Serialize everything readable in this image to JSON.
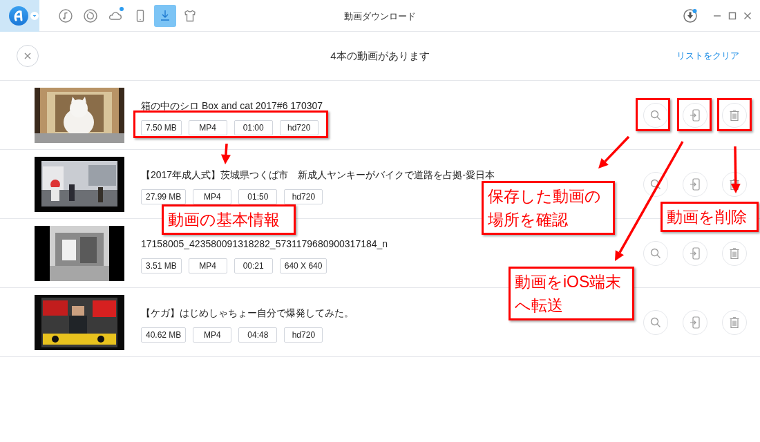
{
  "window": {
    "title": "動画ダウンロード"
  },
  "toolbar": [
    {
      "kind": "music",
      "selected": false,
      "notification": false
    },
    {
      "kind": "restore",
      "selected": false,
      "notification": false
    },
    {
      "kind": "cloud",
      "selected": false,
      "notification": true
    },
    {
      "kind": "phone",
      "selected": false,
      "notification": false
    },
    {
      "kind": "download",
      "selected": true,
      "notification": false
    },
    {
      "kind": "shirt",
      "selected": false,
      "notification": false
    }
  ],
  "download_status": {
    "notification": true
  },
  "header": {
    "title": "4本の動画があります",
    "clear_link": "リストをクリア"
  },
  "videos": [
    {
      "title": "箱の中のシロ Box and cat 2017#6 170307",
      "tags": [
        "7.50 MB",
        "MP4",
        "01:00",
        "hd720"
      ]
    },
    {
      "title": "【2017年成人式】茨城県つくば市　新成人ヤンキーがバイクで道路を占拠-愛日本",
      "tags": [
        "27.99 MB",
        "MP4",
        "01:50",
        "hd720"
      ]
    },
    {
      "title": "17158005_423580091318282_5731179680900317184_n",
      "tags": [
        "3.51 MB",
        "MP4",
        "00:21",
        "640 X 640"
      ]
    },
    {
      "title": "【ケガ】はじめしゃちょー自分で爆発してみた。",
      "tags": [
        "40.62 MB",
        "MP4",
        "04:48",
        "hd720"
      ]
    }
  ],
  "callouts": [
    {
      "lines": [
        "動画の基本情報"
      ]
    },
    {
      "lines": [
        "保存した動画の",
        "場所を確認"
      ]
    },
    {
      "lines": [
        "動画を削除"
      ]
    },
    {
      "lines": [
        "動画をiOS端末",
        "へ転送"
      ]
    }
  ]
}
